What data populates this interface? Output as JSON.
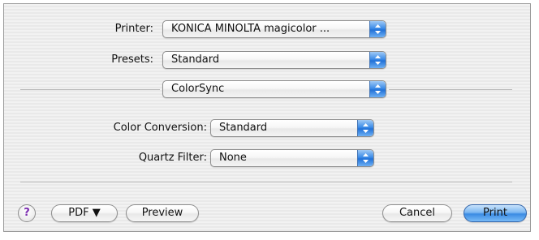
{
  "printer": {
    "label": "Printer:",
    "value": "KONICA MINOLTA magicolor ..."
  },
  "presets": {
    "label": "Presets:",
    "value": "Standard"
  },
  "panel": {
    "value": "ColorSync"
  },
  "color_conversion": {
    "label": "Color Conversion:",
    "value": "Standard"
  },
  "quartz_filter": {
    "label": "Quartz Filter:",
    "value": "None"
  },
  "buttons": {
    "help": "?",
    "pdf": "PDF ▼",
    "preview": "Preview",
    "cancel": "Cancel",
    "print": "Print"
  },
  "colors": {
    "arrow_accent": "#2272d8",
    "print_button": "#3b8be3"
  }
}
